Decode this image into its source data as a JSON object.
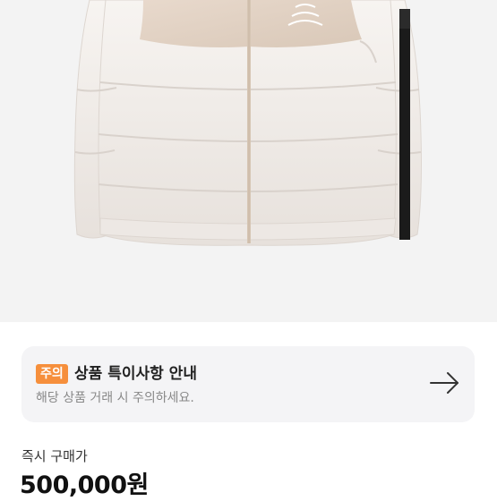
{
  "notice": {
    "badge": "주의",
    "title": "상품 특이사항 안내",
    "subtitle": "해당 상품 거래 시 주의하세요.",
    "action_icon": "arrow-right-icon"
  },
  "price": {
    "label": "즉시 구매가",
    "value": "500,000원"
  },
  "colors": {
    "badge": "#f68f3c",
    "card_background": "#f4f4f6",
    "image_background": "#f3f3f3"
  }
}
